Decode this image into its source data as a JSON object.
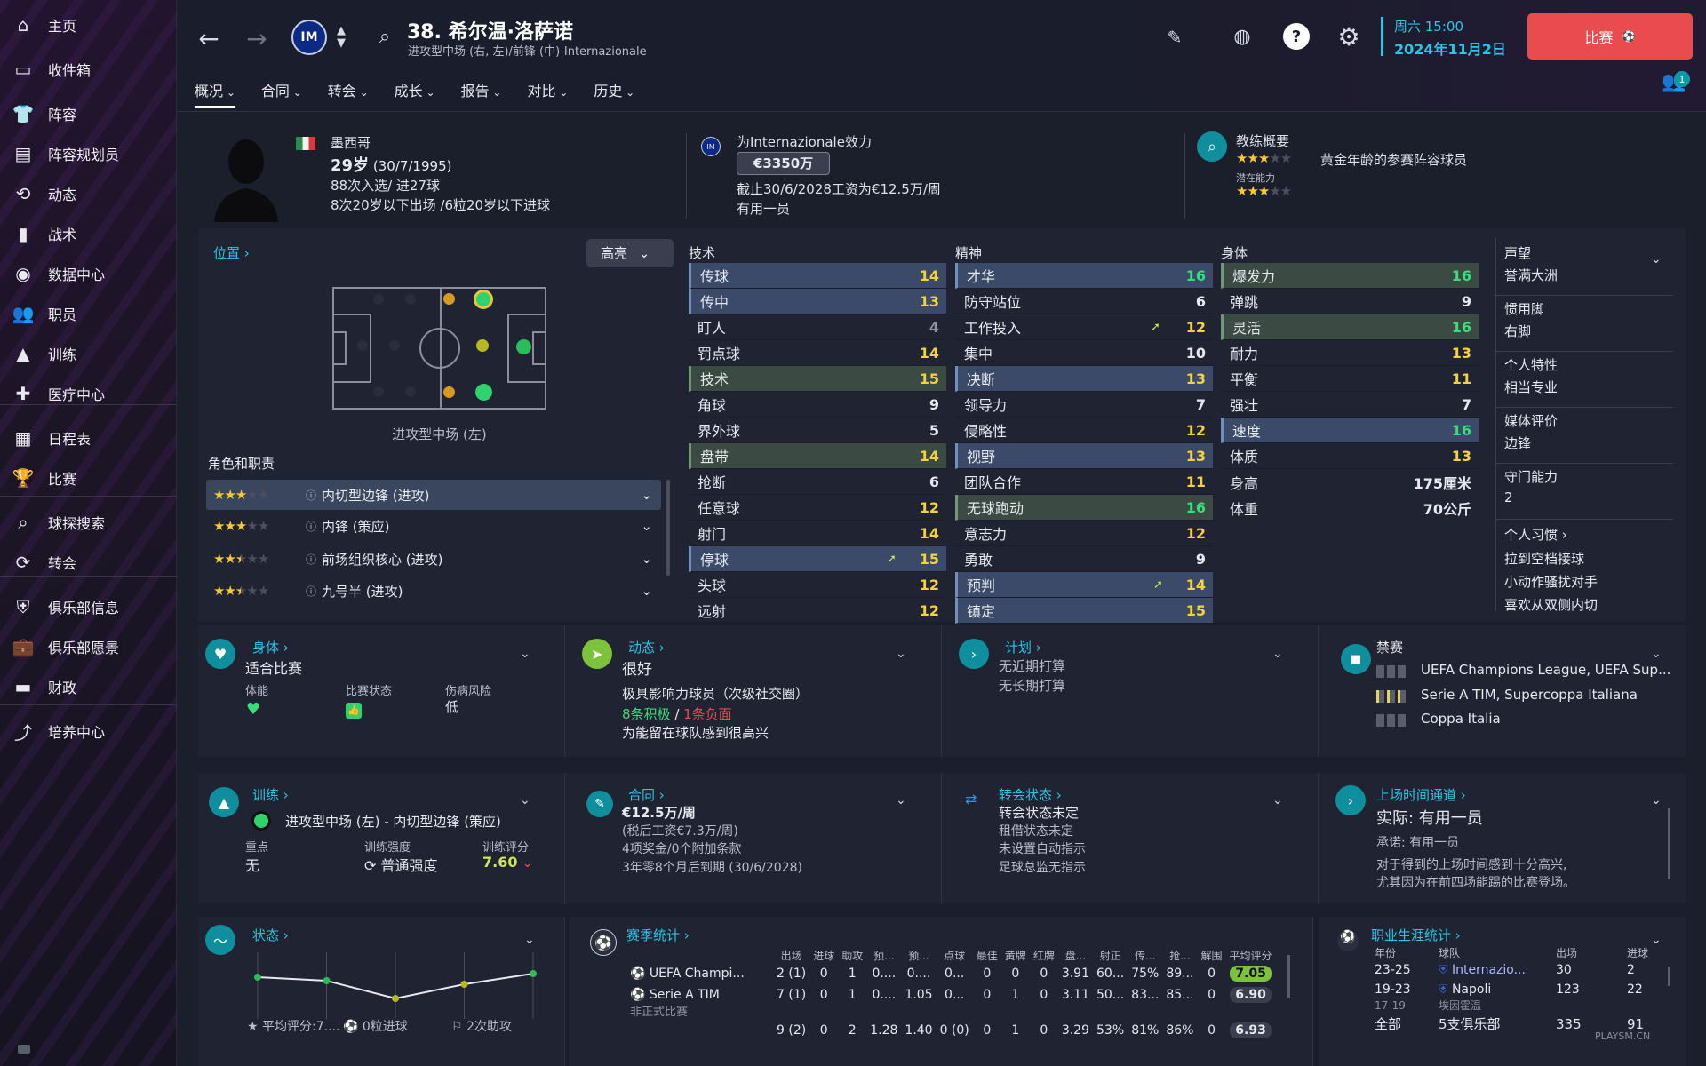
{
  "sidebar": {
    "items": [
      {
        "label": "主页",
        "icon": "home-icon"
      },
      {
        "label": "收件箱",
        "icon": "inbox-icon"
      },
      {
        "label": "阵容",
        "icon": "shirt-icon"
      },
      {
        "label": "阵容规划员",
        "icon": "clipboard-icon"
      },
      {
        "label": "动态",
        "icon": "dynamics-icon"
      },
      {
        "label": "战术",
        "icon": "tactics-icon"
      },
      {
        "label": "数据中心",
        "icon": "data-hub-icon"
      },
      {
        "label": "职员",
        "icon": "staff-icon"
      },
      {
        "label": "训练",
        "icon": "training-icon"
      },
      {
        "label": "医疗中心",
        "icon": "medical-icon"
      },
      {
        "label": "日程表",
        "icon": "calendar-icon"
      },
      {
        "label": "比赛",
        "icon": "trophy-icon"
      },
      {
        "label": "球探搜索",
        "icon": "search-icon"
      },
      {
        "label": "转会",
        "icon": "transfer-icon"
      },
      {
        "label": "俱乐部信息",
        "icon": "shield-icon"
      },
      {
        "label": "俱乐部愿景",
        "icon": "briefcase-icon"
      },
      {
        "label": "财政",
        "icon": "money-icon"
      },
      {
        "label": "培养中心",
        "icon": "development-icon"
      }
    ]
  },
  "header": {
    "title": "38. 希尔温·洛萨诺",
    "subtitle": "进攻型中场 (右, 左)/前锋 (中)-Internazionale",
    "date_day": "周六 15:00",
    "date": "2024年11月2日",
    "match_label": "比赛",
    "notif_count": "1"
  },
  "tabs": [
    "概况",
    "合同",
    "转会",
    "成长",
    "报告",
    "对比",
    "历史"
  ],
  "profile": {
    "nation": "墨西哥",
    "age": "29岁",
    "dob": "(30/7/1995)",
    "caps": "88次入选/ 进27球",
    "youth": "8次20岁以下出场 /6粒20岁以下进球",
    "club_line": "为Internazionale效力",
    "value": "€3350万",
    "contract": "截止30/6/2028工资为€12.5万/周",
    "role": "有用一员",
    "coach_title": "教练概要",
    "coach_desc": "黄金年龄的参赛阵容球员",
    "potential_label": "潜在能力",
    "ability_stars": 3,
    "potential_stars": 3
  },
  "position": {
    "title": "位置",
    "highlight": "高亮",
    "pos_label": "进攻型中场 (左)",
    "roles_title": "角色和职责",
    "roles": [
      {
        "name": "内切型边锋 (进攻)",
        "stars": 3
      },
      {
        "name": "内锋 (策应)",
        "stars": 3
      },
      {
        "name": "前场组织核心 (进攻)",
        "stars": 2.5
      },
      {
        "name": "九号半 (进攻)",
        "stars": 2.5
      }
    ]
  },
  "attributes": {
    "technical_title": "技术",
    "mental_title": "精神",
    "physical_title": "身体",
    "technical": [
      [
        "传球",
        "14"
      ],
      [
        "传中",
        "13"
      ],
      [
        "盯人",
        "4"
      ],
      [
        "罚点球",
        "14"
      ],
      [
        "技术",
        "15"
      ],
      [
        "角球",
        "9"
      ],
      [
        "界外球",
        "5"
      ],
      [
        "盘带",
        "14"
      ],
      [
        "抢断",
        "6"
      ],
      [
        "任意球",
        "12"
      ],
      [
        "射门",
        "14"
      ],
      [
        "停球",
        "15"
      ],
      [
        "头球",
        "12"
      ],
      [
        "远射",
        "12"
      ]
    ],
    "mental": [
      [
        "才华",
        "16"
      ],
      [
        "防守站位",
        "6"
      ],
      [
        "工作投入",
        "12"
      ],
      [
        "集中",
        "10"
      ],
      [
        "决断",
        "13"
      ],
      [
        "领导力",
        "7"
      ],
      [
        "侵略性",
        "12"
      ],
      [
        "视野",
        "13"
      ],
      [
        "团队合作",
        "11"
      ],
      [
        "无球跑动",
        "16"
      ],
      [
        "意志力",
        "12"
      ],
      [
        "勇敢",
        "9"
      ],
      [
        "预判",
        "14"
      ],
      [
        "镇定",
        "15"
      ]
    ],
    "physical": [
      [
        "爆发力",
        "16"
      ],
      [
        "弹跳",
        "9"
      ],
      [
        "灵活",
        "16"
      ],
      [
        "耐力",
        "13"
      ],
      [
        "平衡",
        "11"
      ],
      [
        "强壮",
        "7"
      ],
      [
        "速度",
        "16"
      ],
      [
        "体质",
        "13"
      ]
    ],
    "height_label": "身高",
    "height": "175厘米",
    "weight_label": "体重",
    "weight": "70公斤"
  },
  "info": [
    {
      "k": "声望",
      "v": "誉满大洲"
    },
    {
      "k": "惯用脚",
      "v": "右脚"
    },
    {
      "k": "个人特性",
      "v": "相当专业"
    },
    {
      "k": "媒体评价",
      "v": "边锋"
    },
    {
      "k": "守门能力",
      "v": "2"
    }
  ],
  "habits": {
    "title": "个人习惯",
    "items": [
      "拉到空档接球",
      "小动作骚扰对手",
      "喜欢从双侧内切"
    ]
  },
  "cards": {
    "physical": {
      "title": "身体",
      "status": "适合比赛",
      "c1": "体能",
      "c2": "比赛状态",
      "c3": "伤病风险",
      "risk": "低"
    },
    "dynamics": {
      "title": "动态",
      "status": "很好",
      "line1": "极具影响力球员（次级社交圈）",
      "pos": "8条积极",
      "neg": "1条负面",
      "line3": "为能留在球队感到很高兴"
    },
    "plans": {
      "title": "计划",
      "l1": "无近期打算",
      "l2": "无长期打算"
    },
    "bans": {
      "title": "禁赛",
      "l1": "UEFA Champions League, UEFA Sup...",
      "l2": "Serie A TIM, Supercoppa Italiana",
      "l3": "Coppa Italia"
    },
    "training": {
      "title": "训练",
      "role": "进攻型中场 (左) - 内切型边锋 (策应)",
      "k1": "重点",
      "v1": "无",
      "k2": "训练强度",
      "v2": "普通强度",
      "k3": "训练评分",
      "v3": "7.60"
    },
    "contract": {
      "title": "合同",
      "wage": "€12.5万/周",
      "l1": "(税后工资€7.3万/周)",
      "l2": "4项奖金/0个附加条款",
      "l3": "3年零8个月后到期 (30/6/2028)"
    },
    "transfer": {
      "title": "转会状态",
      "status": "转会状态未定",
      "l1": "租借状态未定",
      "l2": "未设置自动指示",
      "l3": "足球总监无指示"
    },
    "playing": {
      "title": "上场时间通道",
      "actual": "实际: 有用一员",
      "promise": "承诺: 有用一员",
      "l1": "对于得到的上场时间感到十分高兴,",
      "l2": "尤其因为在前四场能踢的比赛登场。"
    },
    "form": {
      "title": "状态",
      "avg": "平均评分:7....",
      "goals": "0粒进球",
      "assists": "2次助攻",
      "points": [
        5.5,
        5.4,
        4.9,
        5.3,
        5.6
      ]
    },
    "season": {
      "title": "赛季统计",
      "cols": [
        "出场",
        "进球",
        "助攻",
        "预...",
        "预...",
        "点球",
        "最佳",
        "黄牌",
        "红牌",
        "盘...",
        "射正",
        "传...",
        "抢...",
        "解围",
        "平均评分"
      ],
      "rows": [
        [
          "UEFA Champi...",
          "2 (1)",
          "0",
          "1",
          "0....",
          "0....",
          "0...",
          "0",
          "0",
          "0",
          "3.91",
          "60...",
          "75%",
          "89...",
          "0",
          "7.05"
        ],
        [
          "Serie A TIM",
          "7 (1)",
          "0",
          "1",
          "0....",
          "1.05",
          "0...",
          "0",
          "1",
          "0",
          "3.11",
          "50...",
          "83...",
          "85...",
          "0",
          "6.90"
        ]
      ],
      "partial": "非正式比赛",
      "total": [
        "9 (2)",
        "0",
        "2",
        "1.28",
        "1.40",
        "0 (0)",
        "0",
        "1",
        "0",
        "3.29",
        "53%",
        "81%",
        "86%",
        "0",
        "6.93"
      ]
    },
    "career": {
      "title": "职业生涯统计",
      "cols": [
        "年份",
        "球队",
        "出场",
        "进球"
      ],
      "rows": [
        [
          "23-25",
          "Internazio...",
          "30",
          "2"
        ],
        [
          "19-23",
          "Napoli",
          "123",
          "22"
        ]
      ],
      "partial": [
        "17-19",
        "埃因霍温"
      ],
      "total": [
        "全部",
        "5支俱乐部",
        "335",
        "91"
      ]
    }
  },
  "watermark": "PLAYSM.CN"
}
